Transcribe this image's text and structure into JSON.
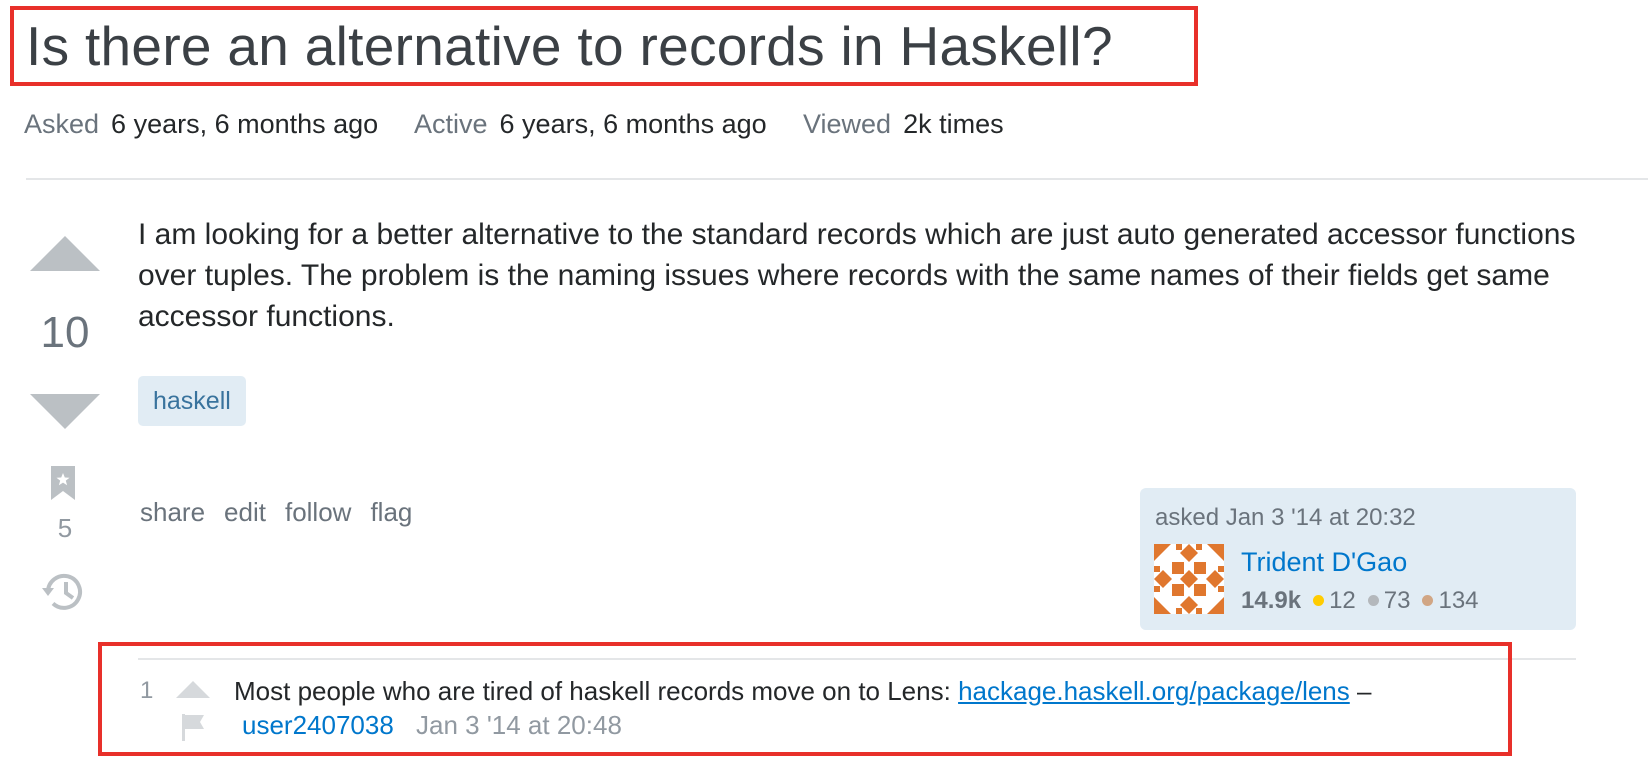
{
  "question": {
    "title": "Is there an alternative to records in Haskell?",
    "meta": {
      "asked_label": "Asked",
      "asked_value": "6 years, 6 months ago",
      "active_label": "Active",
      "active_value": "6 years, 6 months ago",
      "viewed_label": "Viewed",
      "viewed_value": "2k times"
    },
    "vote_count": "10",
    "bookmark_count": "5",
    "body": "I am looking for a better alternative to the standard records which are just auto generated accessor functions over tuples. The problem is the naming issues where records with the same names of their fields get same accessor functions.",
    "tags": [
      "haskell"
    ],
    "menu": {
      "share": "share",
      "edit": "edit",
      "follow": "follow",
      "flag": "flag"
    },
    "owner": {
      "asked_text": "asked Jan 3 '14 at 20:32",
      "name": "Trident D'Gao",
      "reputation": "14.9k",
      "gold": "12",
      "silver": "73",
      "bronze": "134",
      "gold_color": "#ffcc01",
      "silver_color": "#b4b8bc",
      "bronze_color": "#d1a684"
    }
  },
  "comment": {
    "score": "1",
    "text": "Most people who are tired of haskell records move on to Lens: ",
    "link": "hackage.haskell.org/package/lens",
    "dash": " –",
    "user": "user2407038",
    "date": "Jan 3 '14 at 20:48"
  },
  "icons": {
    "vote_up": "arrow-up-icon",
    "vote_down": "arrow-down-icon",
    "bookmark": "bookmark-icon",
    "history": "history-icon",
    "flag": "flag-icon"
  },
  "colors": {
    "highlight": "#e8302a",
    "link": "#0077cc",
    "tag_bg": "#e1ecf4"
  }
}
